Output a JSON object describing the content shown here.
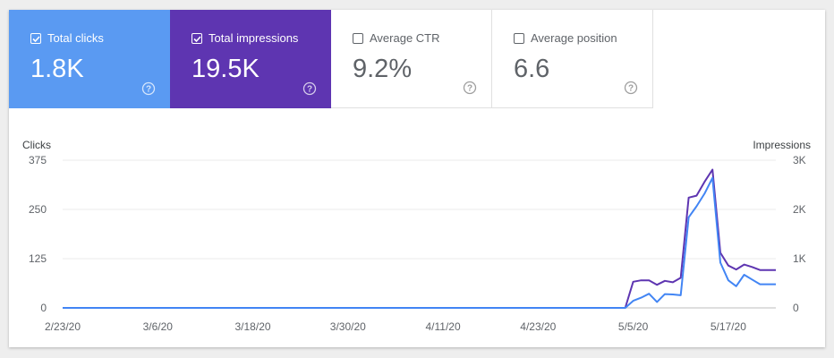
{
  "metrics": [
    {
      "label": "Total clicks",
      "value": "1.8K",
      "checked": true,
      "bg": "#5a9af2",
      "fg": "#ffffff"
    },
    {
      "label": "Total impressions",
      "value": "19.5K",
      "checked": true,
      "bg": "#5e35b1",
      "fg": "#ffffff"
    },
    {
      "label": "Average CTR",
      "value": "9.2%",
      "checked": false,
      "bg": "#ffffff",
      "fg": "#5f6368"
    },
    {
      "label": "Average position",
      "value": "6.6",
      "checked": false,
      "bg": "#ffffff",
      "fg": "#5f6368"
    }
  ],
  "chart_data": {
    "type": "line",
    "ylabel_left": "Clicks",
    "ylabel_right": "Impressions",
    "y_left_ticks": [
      "375",
      "250",
      "125",
      "0"
    ],
    "y_right_ticks": [
      "3K",
      "2K",
      "1K",
      "0"
    ],
    "ylim_left": [
      0,
      375
    ],
    "ylim_right": [
      0,
      3000
    ],
    "x_tick_labels": [
      "2/23/20",
      "3/6/20",
      "3/18/20",
      "3/30/20",
      "4/11/20",
      "4/23/20",
      "5/5/20",
      "5/17/20"
    ],
    "grid": true,
    "series": [
      {
        "name": "Total clicks",
        "color": "#4285f4",
        "axis": "left",
        "x": [
          "4/23/20",
          "5/4/20",
          "5/5/20",
          "5/6/20",
          "5/7/20",
          "5/8/20",
          "5/9/20",
          "5/10/20",
          "5/11/20",
          "5/12/20",
          "5/13/20",
          "5/14/20",
          "5/15/20",
          "5/16/20",
          "5/17/20",
          "5/18/20",
          "5/19/20",
          "5/20/20",
          "5/21/20",
          "5/22/20",
          "5/23/20"
        ],
        "values": [
          0,
          0,
          18,
          26,
          36,
          15,
          35,
          34,
          32,
          230,
          258,
          290,
          330,
          115,
          70,
          55,
          84,
          72,
          60,
          60,
          60
        ]
      },
      {
        "name": "Total impressions",
        "color": "#5e35b1",
        "axis": "right",
        "x": [
          "4/23/20",
          "5/4/20",
          "5/5/20",
          "5/6/20",
          "5/7/20",
          "5/8/20",
          "5/9/20",
          "5/10/20",
          "5/11/20",
          "5/12/20",
          "5/13/20",
          "5/14/20",
          "5/15/20",
          "5/16/20",
          "5/17/20",
          "5/18/20",
          "5/19/20",
          "5/20/20",
          "5/21/20",
          "5/22/20",
          "5/23/20"
        ],
        "values": [
          0,
          0,
          530,
          560,
          560,
          470,
          550,
          520,
          610,
          2240,
          2280,
          2560,
          2810,
          1120,
          860,
          780,
          880,
          830,
          770,
          770,
          770
        ]
      }
    ]
  }
}
